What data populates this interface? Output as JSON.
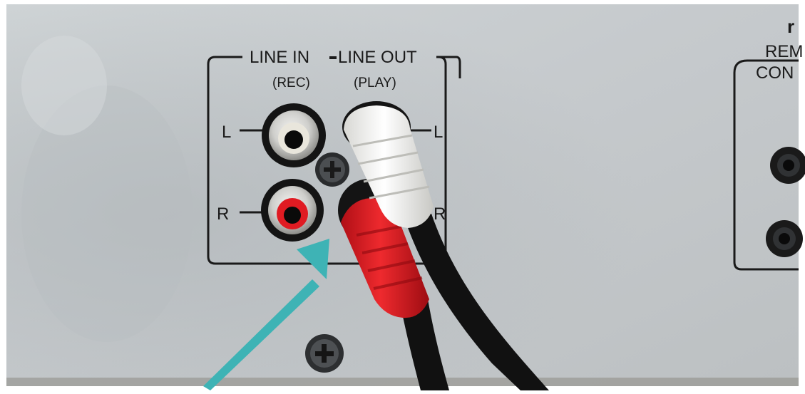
{
  "panel": {
    "title_left": "LINE IN",
    "title_right": "LINE OUT",
    "rec_label": "(REC)",
    "play_label": "(PLAY)",
    "left_channel": "L",
    "right_channel": "R",
    "left_channel_out": "L",
    "right_channel_out": "R"
  },
  "remote_panel": {
    "line1": "REM",
    "line2": "CON",
    "top_glyph": "r"
  },
  "colors": {
    "chassis": "#c9cdd0",
    "arrow": "#3eb3b5",
    "plug_red": "#d81820",
    "plug_white": "#f2f2f0",
    "cable": "#111111"
  }
}
